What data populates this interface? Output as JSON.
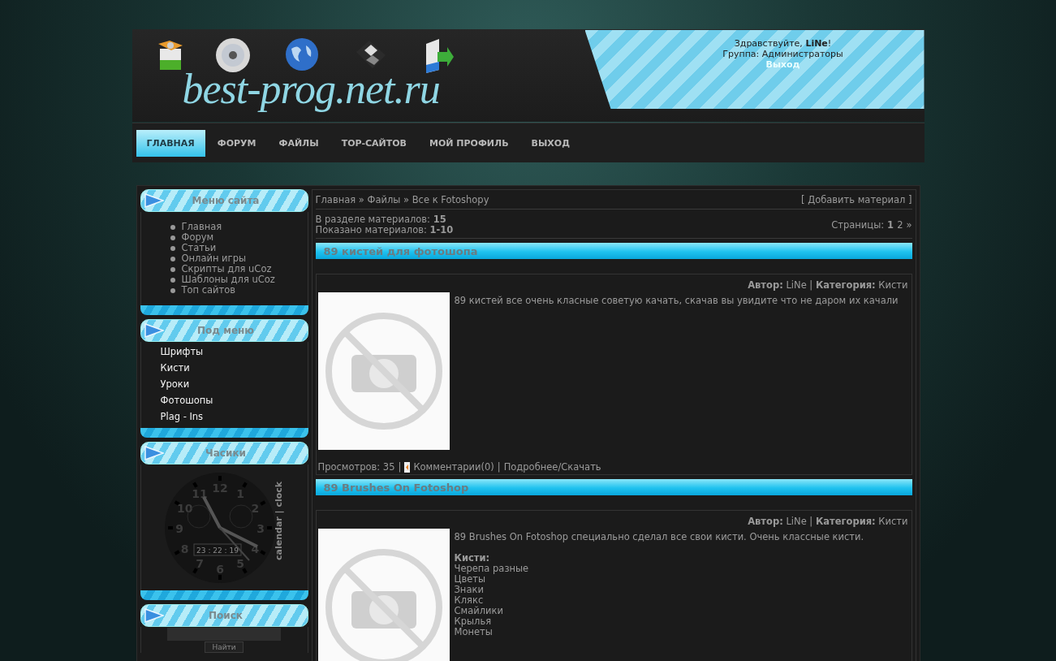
{
  "header": {
    "logo": "best-prog.net.ru",
    "greeting": "Здравствуйте, **LiNe**!",
    "group": "Группа: Администраторы",
    "logout": "Выход"
  },
  "nav": [
    {
      "label": "ГЛАВНАЯ",
      "selected": true
    },
    {
      "label": "ФОРУМ",
      "selected": false
    },
    {
      "label": "ФАЙЛЫ",
      "selected": false
    },
    {
      "label": "TOP-САЙТОВ",
      "selected": false
    },
    {
      "label": "МОЙ ПРОФИЛЬ",
      "selected": false
    },
    {
      "label": "ВЫХОД",
      "selected": false
    }
  ],
  "sidebar": [
    {
      "kind": "bullets",
      "title": "Меню сайта",
      "items": [
        "Главная",
        "Форум",
        "Статьи",
        "Онлайн игры",
        "Скрипты для uCoz",
        "Шаблоны для uCoz",
        "Топ сайтов"
      ]
    },
    {
      "kind": "links",
      "title": "Под меню",
      "items": [
        "Шрифты",
        "Кисти",
        "Уроки",
        "Фотошопы",
        "Plag - Ins"
      ]
    },
    {
      "kind": "clock",
      "title": "Часики",
      "dial": [
        "11",
        "12",
        "1",
        "10",
        "2",
        "9",
        "3",
        "8",
        "4",
        "7",
        "6",
        "5"
      ],
      "time": "23 : 22 : 19",
      "brand": "calendar | clock"
    },
    {
      "kind": "search",
      "title": "Поиск",
      "button": "Найти"
    }
  ],
  "content": {
    "breadcrumb": "Главная » Файлы » Все к Fotoshopy",
    "add_link": "[ Добавить материал ]",
    "count": "В разделе материалов: **15**",
    "shown": "Показано материалов: **1-10**",
    "pages_label": "Страницы:",
    "pages": [
      {
        "label": "1",
        "selected": true
      },
      {
        "label": "2",
        "selected": false
      }
    ],
    "pages_next": "»",
    "entries": [
      {
        "title": "89 кистей для фотошопа",
        "meta": "**Автор:** LiNe | **Категория:** Кисти",
        "description": "89 кистей все очень класные советую качать, скачав вы увидите что не даром их качали",
        "views": "Просмотров: 35",
        "separator": "|",
        "comments": "Комментарии(0)",
        "more": "Подробнее/Скачать"
      },
      {
        "title": "89 Brushes On Fotoshop",
        "meta": "**Автор:** LiNe | **Категория:** Кисти",
        "description": "89 Brushes On Fotoshop специально сделал все свои кисти. Очень классные кисти.",
        "list_heading": "Кисти:",
        "list": [
          "Черепа разные",
          "Цветы",
          "Знаки",
          "Клякс",
          "Смайлики",
          "Крылья",
          "Монеты"
        ]
      }
    ]
  }
}
